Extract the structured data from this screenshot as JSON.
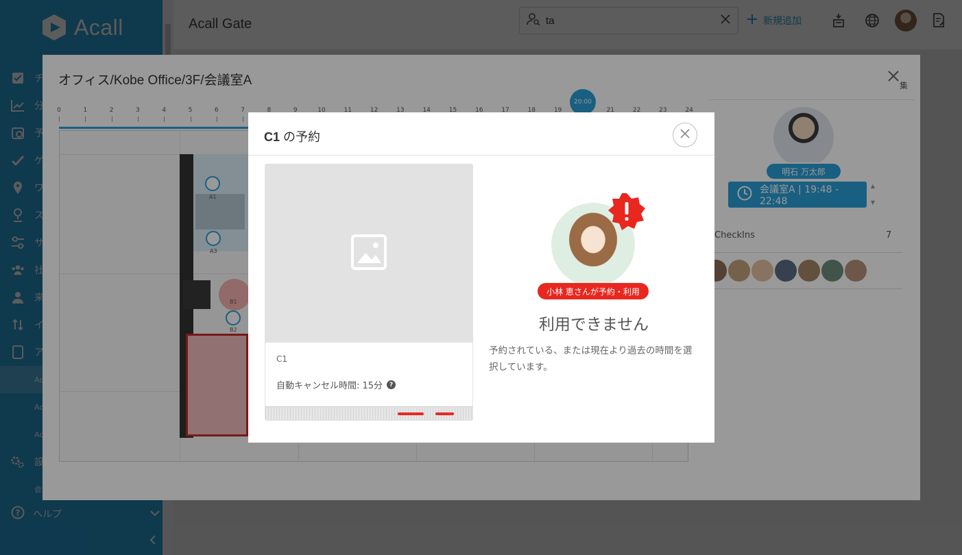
{
  "app": {
    "brand": "Acall",
    "title": "Acall Gate"
  },
  "search": {
    "value": "ta"
  },
  "header": {
    "add_new": "新規追加"
  },
  "sidebar": {
    "items": [
      {
        "label": "チ",
        "icon": "checkbox-icon"
      },
      {
        "label": "分",
        "icon": "chart-line-icon"
      },
      {
        "label": "予",
        "icon": "calendar-clock-icon"
      },
      {
        "label": "ゲ",
        "icon": "checkmark-icon"
      },
      {
        "label": "ワ",
        "icon": "map-pin-icon"
      },
      {
        "label": "ス",
        "icon": "location-person-icon"
      },
      {
        "label": "サ",
        "icon": "sliders-icon"
      },
      {
        "label": "社",
        "icon": "users-icon"
      },
      {
        "label": "来",
        "icon": "user-group-icon"
      },
      {
        "label": "イ",
        "icon": "sort-icon"
      },
      {
        "label": "ア",
        "icon": "tablet-icon"
      }
    ],
    "sub_items": [
      "Ac",
      "Ac",
      "Ac"
    ],
    "settings": {
      "label": "設",
      "sub": "会"
    },
    "help": "ヘルプ"
  },
  "modal1": {
    "title": "オフィス/Kobe Office/3F/会議室A",
    "ruler_ticks": [
      "0",
      "1",
      "2",
      "3",
      "4",
      "5",
      "6",
      "7",
      "8",
      "9",
      "10",
      "11",
      "12",
      "13",
      "14",
      "15",
      "16",
      "17",
      "18",
      "19",
      "20",
      "21",
      "22",
      "23",
      "24"
    ],
    "current_time": "20:00",
    "seats": [
      "A1",
      "A3",
      "B1",
      "B2"
    ],
    "right": {
      "header_text": "集",
      "user_name": "明石 万太郎",
      "room_booking": "会議室A | 19:48 - 22:48",
      "checkins_label": "CheckIns",
      "checkins_count": "7"
    }
  },
  "modal2": {
    "title_bold": "C1",
    "title_rest": " の予約",
    "seat_name": "C1",
    "auto_cancel": "自動キャンセル時間: 15分",
    "user_using": "小林 恵さんが予約・利用",
    "status": "利用できません",
    "description": "予約されている、または現在より過去の時間を選択しています。"
  },
  "colors": {
    "accent": "#2b9fd8",
    "error": "#e8271f"
  }
}
